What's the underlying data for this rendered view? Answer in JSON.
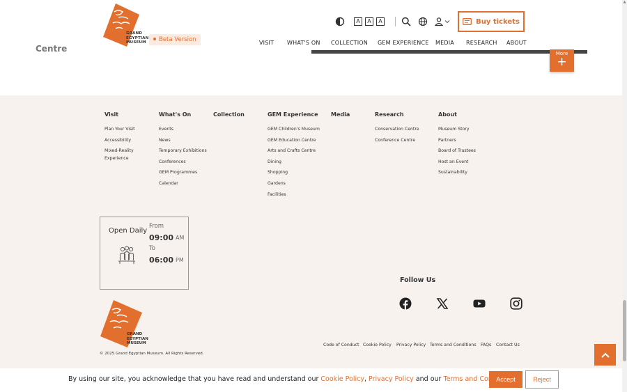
{
  "colors": {
    "accent": "#e36f2e",
    "footer_bg": "#f7f2ee",
    "header_bg": "#ffffff"
  },
  "header": {
    "logo_text": "GRAND EGYPTIAN MUSEUM",
    "beta_label": "Beta Version",
    "hidden_heading": "Centre",
    "font_sizes": [
      "A",
      "A",
      "A"
    ],
    "buy_tickets": "Buy tickets",
    "nav": [
      "VISIT",
      "WHAT'S ON",
      "COLLECTION",
      "GEM EXPERIENCE",
      "MEDIA",
      "RESEARCH",
      "ABOUT"
    ],
    "icons": [
      "contrast-icon",
      "search-icon",
      "globe-icon",
      "user-icon",
      "chevron-down-icon",
      "ticket-icon"
    ]
  },
  "more_button": {
    "label": "More",
    "symbol": "+"
  },
  "footer": {
    "columns": [
      {
        "title": "Visit",
        "items": [
          "Plan Your Visit",
          "Accessibility",
          "Mixed-Reality Experience"
        ]
      },
      {
        "title": "What's On",
        "items": [
          "Events",
          "News",
          "Temporary Exhibitions",
          "Conferences",
          "GEM Programmes",
          "Calendar"
        ]
      },
      {
        "title": "Collection",
        "items": []
      },
      {
        "title": "GEM Experience",
        "items": [
          "GEM Children's Museum",
          "GEM Education Centre",
          "Arts and Crafts Centre",
          "Dining",
          "Shopping",
          "Gardens",
          "Facilities"
        ]
      },
      {
        "title": "Media",
        "items": []
      },
      {
        "title": "Research",
        "items": [
          "Conservation Centre",
          "Conference Centre"
        ]
      },
      {
        "title": "About",
        "items": [
          "Museum Story",
          "Partners",
          "Board of Trustees",
          "Host an Event",
          "Sustainability"
        ]
      }
    ],
    "open_daily": {
      "title": "Open Daily",
      "from_label": "From",
      "from_time": "09:00",
      "from_ampm": "AM",
      "to_label": "To",
      "to_time": "06:00",
      "to_ampm": "PM"
    },
    "follow_us": "Follow Us",
    "social": [
      "facebook-icon",
      "x-icon",
      "youtube-icon",
      "instagram-icon"
    ],
    "logo_text": "GRAND EGYPTIAN MUSEUM",
    "copyright": "© 2025 Grand Egyptian Museum. All Rights Reserved.",
    "legal_links": [
      "Code of Conduct",
      "Cookie Policy",
      "Privacy Policy",
      "Terms and Conditions",
      "FAQs",
      "Contact Us"
    ]
  },
  "cookie_bar": {
    "text_before": "By using our site, you acknowledge that you have read and understand our ",
    "cookie_policy": "Cookie Policy",
    "comma": ", ",
    "privacy_policy": "Privacy Policy",
    "and_our": " and our ",
    "terms": "Terms and Conditions",
    "period": ".",
    "accept": "Accept",
    "reject": "Reject"
  }
}
